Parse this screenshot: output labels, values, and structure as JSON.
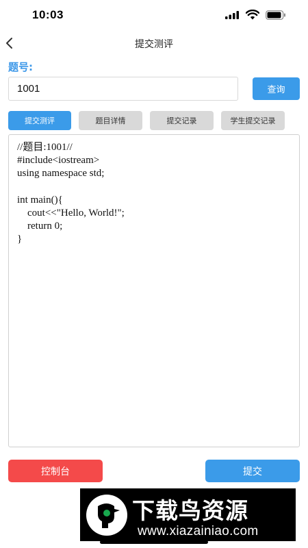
{
  "status_bar": {
    "time": "10:03"
  },
  "nav": {
    "title": "提交测评"
  },
  "problem": {
    "label": "题号:",
    "value": "1001",
    "query_label": "查询"
  },
  "tabs": [
    {
      "label": "提交测评",
      "active": true
    },
    {
      "label": "题目详情",
      "active": false
    },
    {
      "label": "提交记录",
      "active": false
    },
    {
      "label": "学生提交记录",
      "active": false
    }
  ],
  "editor": {
    "code": "//题目:1001//\n#include<iostream>\nusing namespace std;\n\nint main(){\n    cout<<\"Hello, World!\";\n    return 0;\n}"
  },
  "actions": {
    "console_label": "控制台",
    "submit_label": "提交"
  },
  "watermark": {
    "site_name": "下载鸟资源",
    "url": "www.xiazainiao.com"
  },
  "colors": {
    "accent": "#3b9be9",
    "danger": "#f44a4a",
    "tab_inactive": "#d9d9d9"
  }
}
